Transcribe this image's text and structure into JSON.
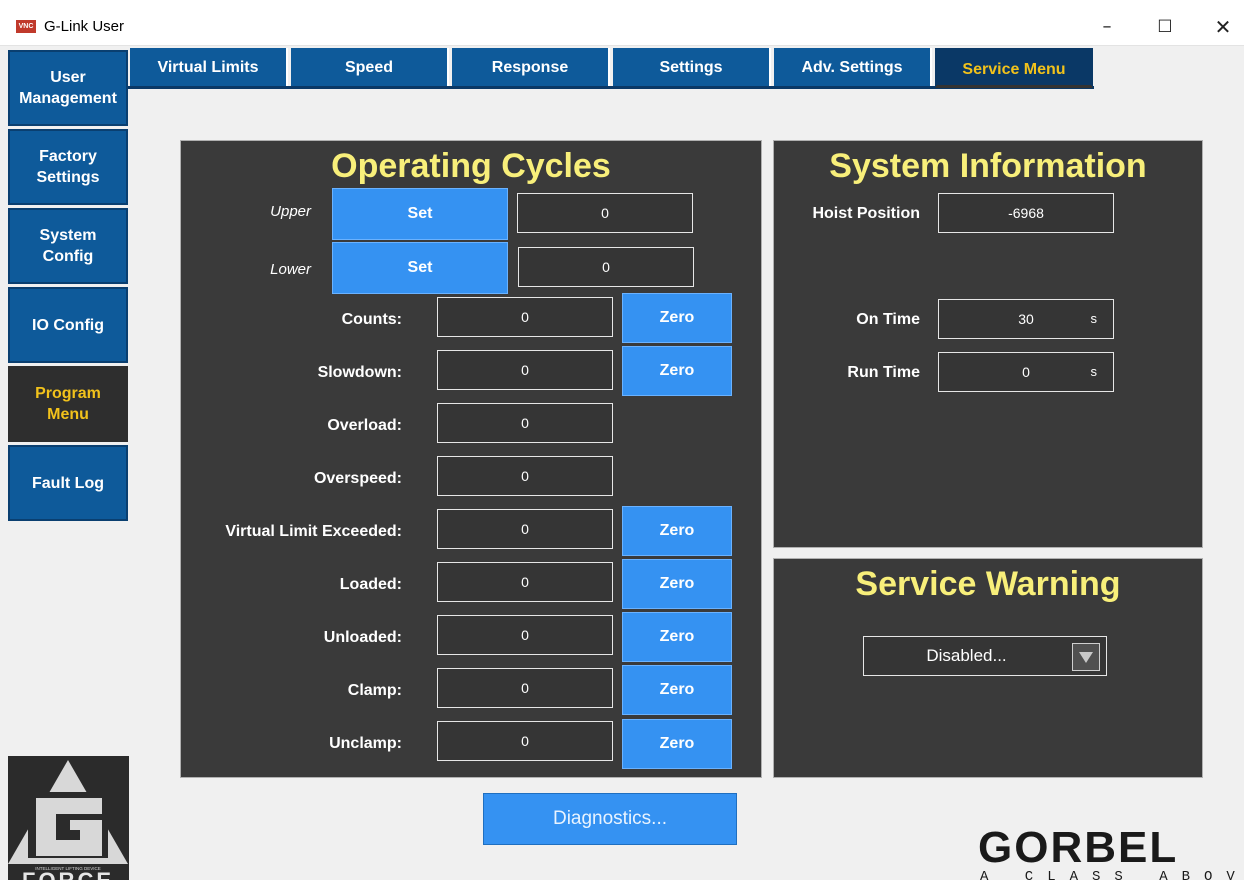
{
  "window": {
    "title": "G-Link User",
    "icon_text": "VNC",
    "min": "–",
    "max": "☐",
    "close": "✕"
  },
  "sidebar": {
    "items": [
      {
        "label": "User Management"
      },
      {
        "label": "Factory Settings"
      },
      {
        "label": "System Config"
      },
      {
        "label": "IO Config"
      },
      {
        "label": "Program Menu",
        "active": true
      },
      {
        "label": "Fault Log"
      }
    ]
  },
  "tabs": [
    {
      "label": "Virtual Limits"
    },
    {
      "label": "Speed"
    },
    {
      "label": "Response"
    },
    {
      "label": "Settings"
    },
    {
      "label": "Adv. Settings"
    },
    {
      "label": "Service Menu",
      "active": true
    }
  ],
  "operating_cycles": {
    "title": "Operating Cycles",
    "upper": {
      "label": "Upper",
      "button": "Set",
      "value": "0"
    },
    "lower": {
      "label": "Lower",
      "button": "Set",
      "value": "0"
    },
    "rows": [
      {
        "label": "Counts:",
        "value": "0",
        "zero": "Zero"
      },
      {
        "label": "Slowdown:",
        "value": "0",
        "zero": "Zero"
      },
      {
        "label": "Overload:",
        "value": "0"
      },
      {
        "label": "Overspeed:",
        "value": "0"
      },
      {
        "label": "Virtual Limit Exceeded:",
        "value": "0",
        "zero": "Zero"
      },
      {
        "label": "Loaded:",
        "value": "0",
        "zero": "Zero"
      },
      {
        "label": "Unloaded:",
        "value": "0",
        "zero": "Zero"
      },
      {
        "label": "Clamp:",
        "value": "0",
        "zero": "Zero"
      },
      {
        "label": "Unclamp:",
        "value": "0",
        "zero": "Zero"
      }
    ]
  },
  "system_info": {
    "title": "System Information",
    "hoist": {
      "label": "Hoist Position",
      "value": "-6968"
    },
    "on_time": {
      "label": "On Time",
      "value": "30",
      "unit": "s"
    },
    "run_time": {
      "label": "Run Time",
      "value": "0",
      "unit": "s"
    }
  },
  "service_warning": {
    "title": "Service Warning",
    "selected": "Disabled..."
  },
  "diagnostics_label": "Diagnostics...",
  "logos": {
    "gforce_text": "FORCE",
    "gforce_tagline": "INTELLIGENT LIFTING DEVICE",
    "gorbel_text": "GORBEL",
    "gorbel_tagline": "A CLASS ABOVE"
  },
  "colors": {
    "nav_blue": "#0e5a9a",
    "button_blue": "#3592f2",
    "panel_bg": "#3a3a3a",
    "title_yellow": "#f8ef7a",
    "active_yellow": "#f2c21b"
  }
}
